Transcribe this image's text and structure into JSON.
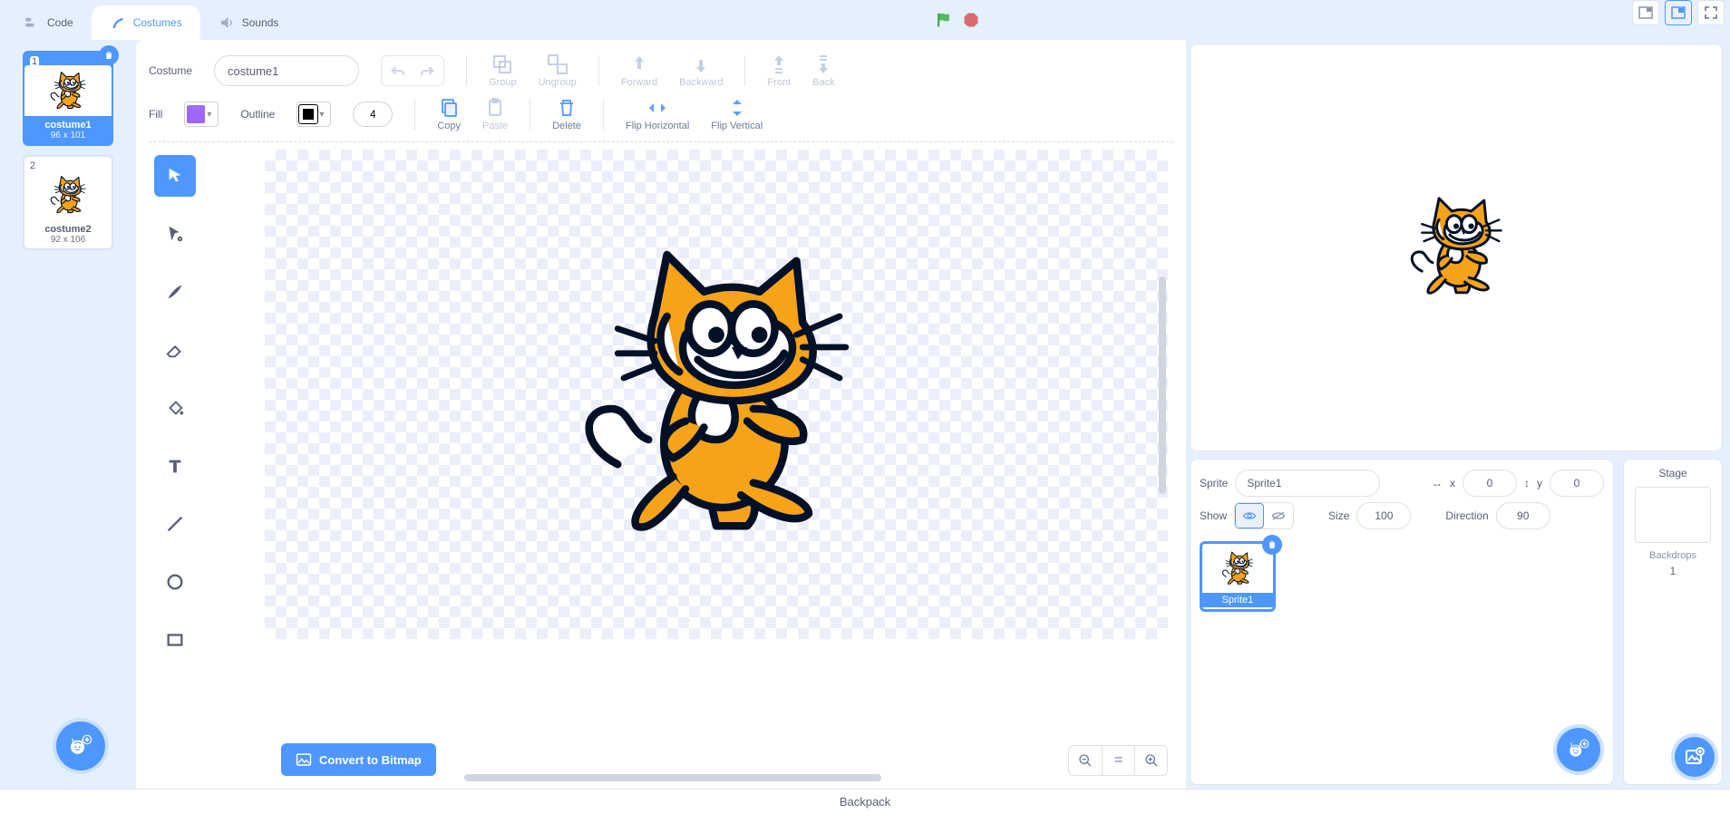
{
  "tabs": {
    "code": "Code",
    "costumes": "Costumes",
    "sounds": "Sounds",
    "active": "costumes"
  },
  "costume_list": [
    {
      "index": "1",
      "name": "costume1",
      "size": "96 x 101",
      "active": true
    },
    {
      "index": "2",
      "name": "costume2",
      "size": "92 x 106",
      "active": false
    }
  ],
  "editor": {
    "costume_label": "Costume",
    "costume_name": "costume1",
    "group": "Group",
    "ungroup": "Ungroup",
    "forward": "Forward",
    "backward": "Backward",
    "front": "Front",
    "back": "Back",
    "fill_label": "Fill",
    "outline_label": "Outline",
    "outline_width": "4",
    "copy": "Copy",
    "paste": "Paste",
    "delete": "Delete",
    "flip_h": "Flip Horizontal",
    "flip_v": "Flip Vertical",
    "convert": "Convert to Bitmap",
    "fill_color": "#9966ff",
    "outline_color": "#000000"
  },
  "tools": [
    "select",
    "reshape",
    "brush",
    "eraser",
    "fill",
    "text",
    "line",
    "circle",
    "rect"
  ],
  "sprite_info": {
    "sprite_label": "Sprite",
    "sprite_name": "Sprite1",
    "x_label": "x",
    "x_value": "0",
    "y_label": "y",
    "y_value": "0",
    "show_label": "Show",
    "size_label": "Size",
    "size_value": "100",
    "direction_label": "Direction",
    "direction_value": "90"
  },
  "stage_panel": {
    "title": "Stage",
    "backdrops_label": "Backdrops",
    "backdrops_count": "1"
  },
  "backpack_label": "Backpack"
}
